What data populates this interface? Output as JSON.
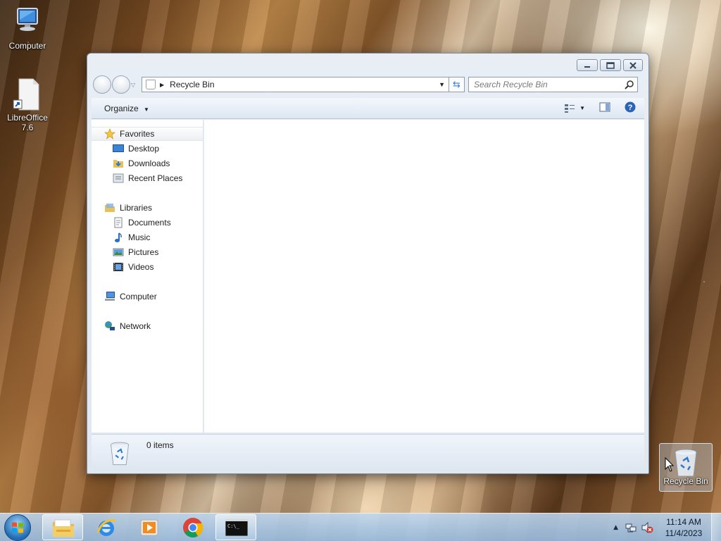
{
  "desktop": {
    "icons": [
      {
        "label": "Computer",
        "icon": "computer-icon"
      },
      {
        "label": "LibreOffice\n7.6",
        "icon": "libreoffice-shortcut-icon"
      },
      {
        "label": "Recycle Bin",
        "icon": "recycle-bin-icon"
      }
    ]
  },
  "window": {
    "address": {
      "location": "Recycle Bin"
    },
    "search": {
      "placeholder": "Search Recycle Bin"
    },
    "toolbar": {
      "organize_label": "Organize"
    },
    "nav": {
      "favorites": {
        "label": "Favorites",
        "items": [
          "Desktop",
          "Downloads",
          "Recent Places"
        ]
      },
      "libraries": {
        "label": "Libraries",
        "items": [
          "Documents",
          "Music",
          "Pictures",
          "Videos"
        ]
      },
      "computer": "Computer",
      "network": "Network"
    },
    "details": {
      "item_count": "0 items"
    }
  },
  "taskbar": {
    "clock_time": "11:14 AM",
    "clock_date": "11/4/2023",
    "pinned": [
      "windows-explorer-icon",
      "internet-explorer-icon",
      "media-player-icon",
      "chrome-icon",
      "command-prompt-icon"
    ]
  },
  "colors": {
    "accent": "#3d7fc4",
    "selection": "#eceff3"
  }
}
